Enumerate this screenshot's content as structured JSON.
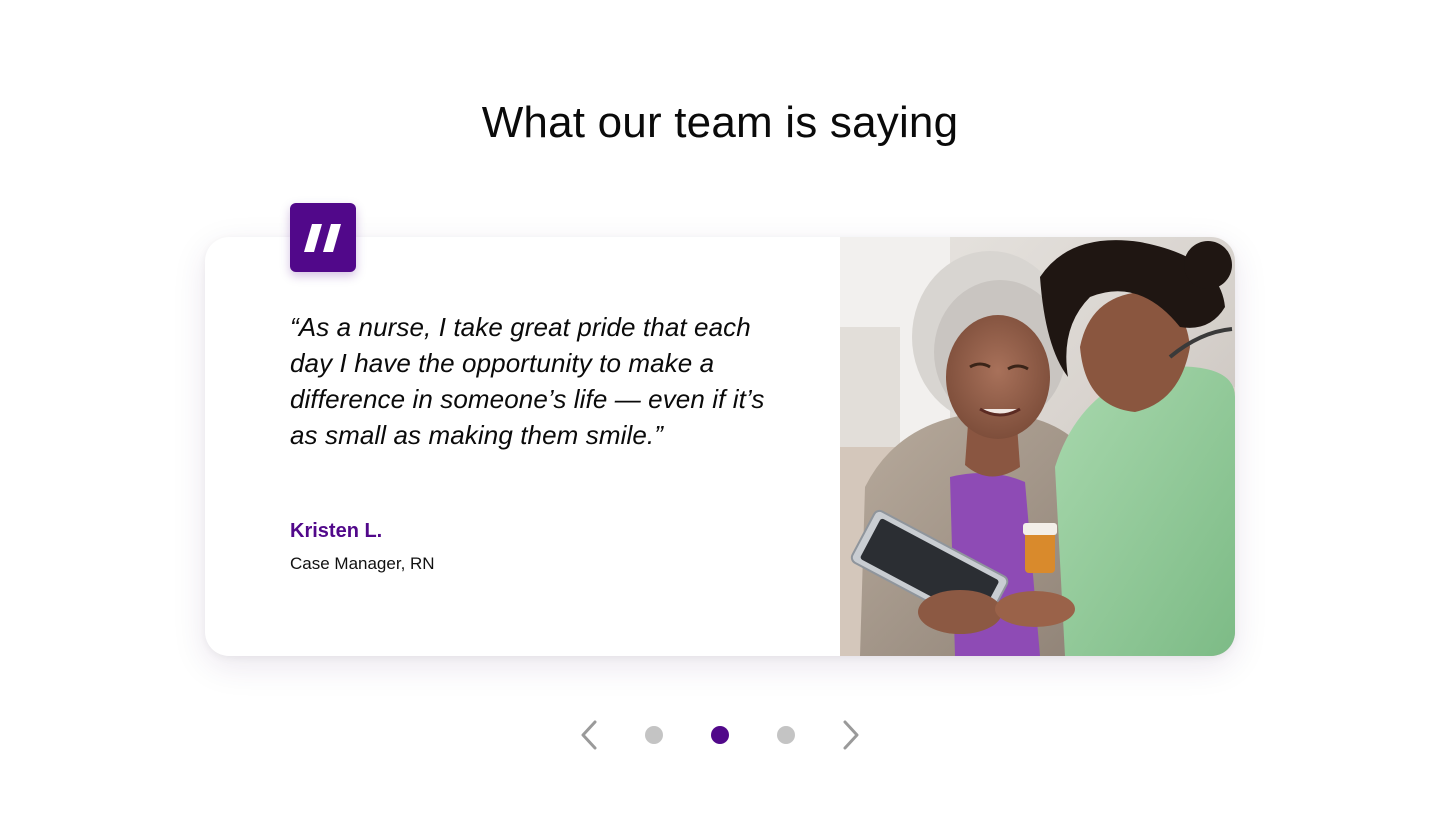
{
  "section": {
    "heading": "What our team is saying"
  },
  "testimonial": {
    "quote": "“As a nurse, I take great pride that each day I have the opportunity to make a difference in someone’s life — even if it’s as small as making them smile.”",
    "author_name": "Kristen L.",
    "author_role": "Case Manager, RN",
    "photo_subject": "nurse-with-senior-patient-photo"
  },
  "carousel": {
    "slide_count": 3,
    "active_index": 1,
    "prev_icon": "chevron-left-icon",
    "next_icon": "chevron-right-icon"
  },
  "colors": {
    "brand_purple": "#51088a",
    "dot_inactive": "#c4c4c4",
    "arrow": "#9a9a9a"
  }
}
